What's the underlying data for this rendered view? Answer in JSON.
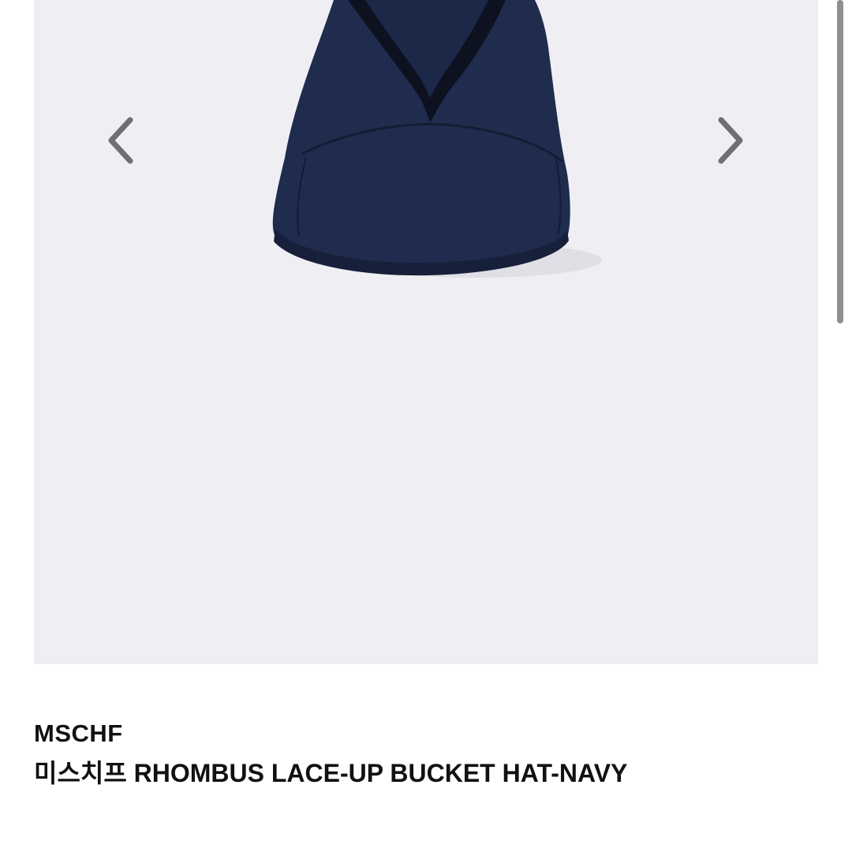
{
  "product": {
    "brand": "MSCHF",
    "title": "미스치프 RHOMBUS LACE-UP BUCKET HAT-NAVY"
  },
  "gallery": {
    "prev_icon": "chevron-left-icon",
    "next_icon": "chevron-right-icon",
    "background_color": "#efeff3",
    "arrow_color": "#6e6e73"
  },
  "colors": {
    "hat_navy": "#1f2c4e",
    "hat_navy_dark": "#141c33",
    "lace_black": "#0d1120"
  }
}
